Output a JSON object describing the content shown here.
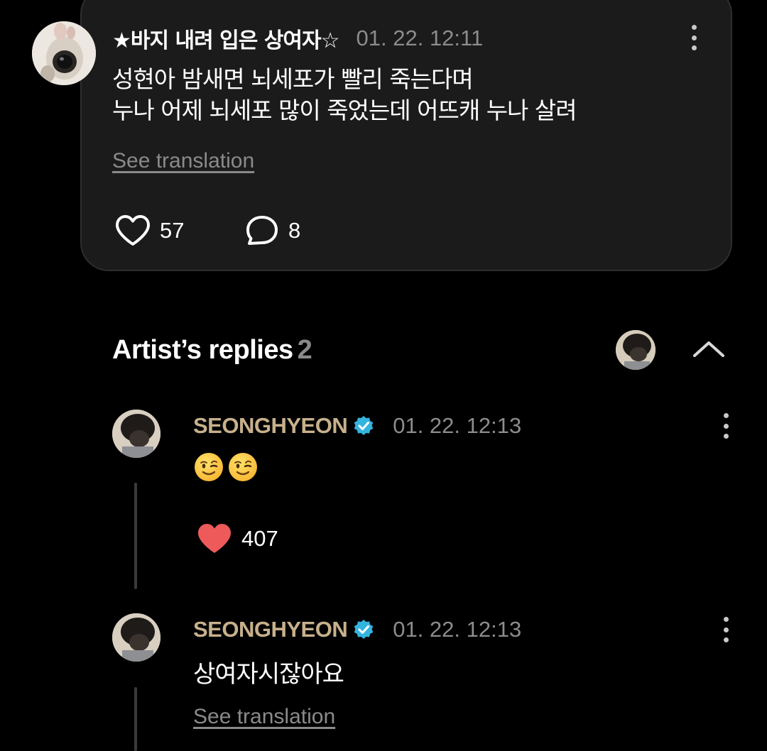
{
  "post": {
    "author": "★바지 내려 입은 상여자☆",
    "timestamp": "01. 22. 12:11",
    "body": "성현아 밤새면 뇌세포가 빨리 죽는다며\n누나 어제 뇌세포 많이 죽었는데 어뜨캐 누나 살려",
    "see_translation": "See translation",
    "like_count": "57",
    "comment_count": "8",
    "like_icon": "heart-outline-icon",
    "comment_icon": "speech-bubble-icon"
  },
  "artist_replies": {
    "title": "Artist’s replies",
    "count": "2",
    "collapse_icon": "chevron-up-icon",
    "replies": [
      {
        "author": "SEONGHYEON",
        "verified_icon": "verified-badge-icon",
        "timestamp": "01. 22. 12:13",
        "body_emojis": [
          "winking-face-emoji",
          "winking-face-emoji"
        ],
        "like_count": "407",
        "like_icon": "heart-filled-icon"
      },
      {
        "author": "SEONGHYEON",
        "verified_icon": "verified-badge-icon",
        "timestamp": "01. 22. 12:13",
        "body": "상여자시잖아요",
        "see_translation": "See translation"
      }
    ]
  },
  "colors": {
    "background": "#000000",
    "card": "#1b1b1b",
    "artist_name": "#c7b08c",
    "verified": "#33b4de",
    "liked_heart": "#ee5a5a",
    "muted_text": "#8c8c8c"
  }
}
